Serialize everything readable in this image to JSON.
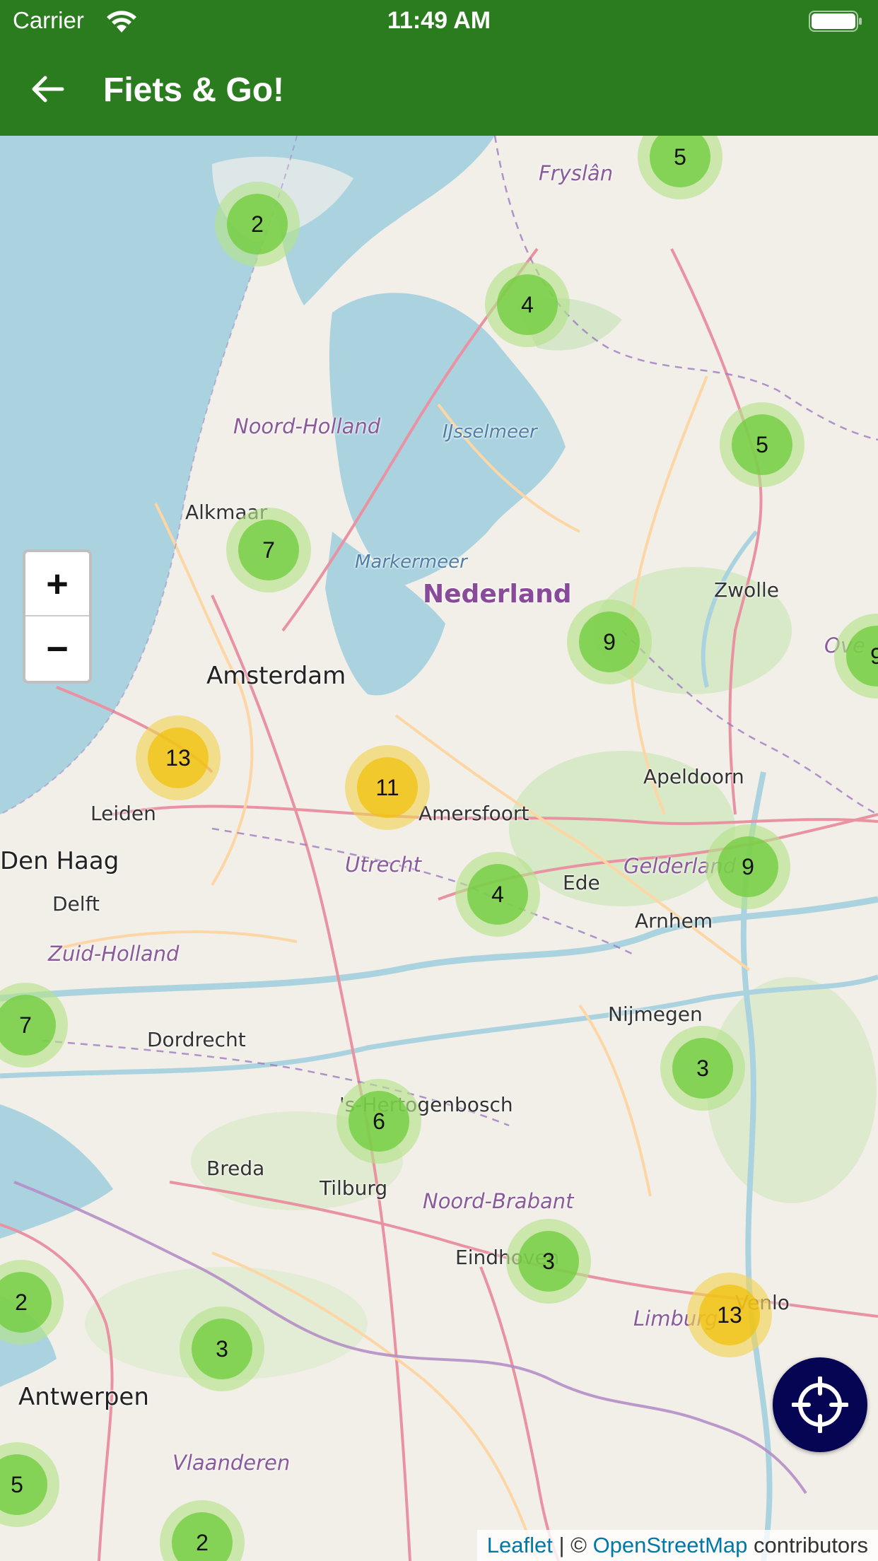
{
  "status_bar": {
    "carrier": "Carrier",
    "time": "11:49 AM"
  },
  "app_bar": {
    "title": "Fiets & Go!",
    "back_icon": "arrow-left-icon"
  },
  "colors": {
    "app_bar": "#2b7b1f",
    "cluster_small": "#6ecc39",
    "cluster_medium": "#f0c20c",
    "locate_button": "#050554",
    "water": "#aad3df"
  },
  "map": {
    "zoom_in_label": "+",
    "zoom_out_label": "−",
    "locate_icon": "crosshair-icon",
    "places": {
      "fryslan": "Fryslân",
      "noord_holland": "Noord-Holland",
      "ijsselmeer": "IJsselmeer",
      "alkmaar": "Alkmaar",
      "markermeer": "Markermeer",
      "nederland": "Nederland",
      "zwolle": "Zwolle",
      "overijssel": "Ove",
      "amsterdam": "Amsterdam",
      "apeldoorn": "Apeldoorn",
      "leiden": "Leiden",
      "amersfoort": "Amersfoort",
      "den_haag": "Den Haag",
      "utrecht": "Utrecht",
      "ede": "Ede",
      "gelderland": "Gelderland",
      "delft": "Delft",
      "arnhem": "Arnhem",
      "zuid_holland": "Zuid-Holland",
      "nijmegen": "Nijmegen",
      "dordrecht": "Dordrecht",
      "hertogenbosch": "'s-Hertogenbosch",
      "breda": "Breda",
      "tilburg": "Tilburg",
      "noord_brabant": "Noord-Brabant",
      "eindhoven": "Eindhoven",
      "venlo": "Venlo",
      "limburg": "Limburg",
      "antwerpen": "Antwerpen",
      "vlaanderen": "Vlaanderen"
    },
    "clusters": [
      {
        "count": "5",
        "size": "small"
      },
      {
        "count": "2",
        "size": "small"
      },
      {
        "count": "4",
        "size": "small"
      },
      {
        "count": "5",
        "size": "small"
      },
      {
        "count": "7",
        "size": "small"
      },
      {
        "count": "9",
        "size": "small"
      },
      {
        "count": "9",
        "size": "small"
      },
      {
        "count": "13",
        "size": "medium"
      },
      {
        "count": "11",
        "size": "medium"
      },
      {
        "count": "4",
        "size": "small"
      },
      {
        "count": "9",
        "size": "small"
      },
      {
        "count": "7",
        "size": "small"
      },
      {
        "count": "3",
        "size": "small"
      },
      {
        "count": "6",
        "size": "small"
      },
      {
        "count": "3",
        "size": "small"
      },
      {
        "count": "13",
        "size": "medium"
      },
      {
        "count": "2",
        "size": "small"
      },
      {
        "count": "3",
        "size": "small"
      },
      {
        "count": "5",
        "size": "small"
      },
      {
        "count": "2",
        "size": "small"
      }
    ],
    "attribution": {
      "leaflet": "Leaflet",
      "separator": " | © ",
      "osm": "OpenStreetMap",
      "suffix": " contributors"
    }
  }
}
